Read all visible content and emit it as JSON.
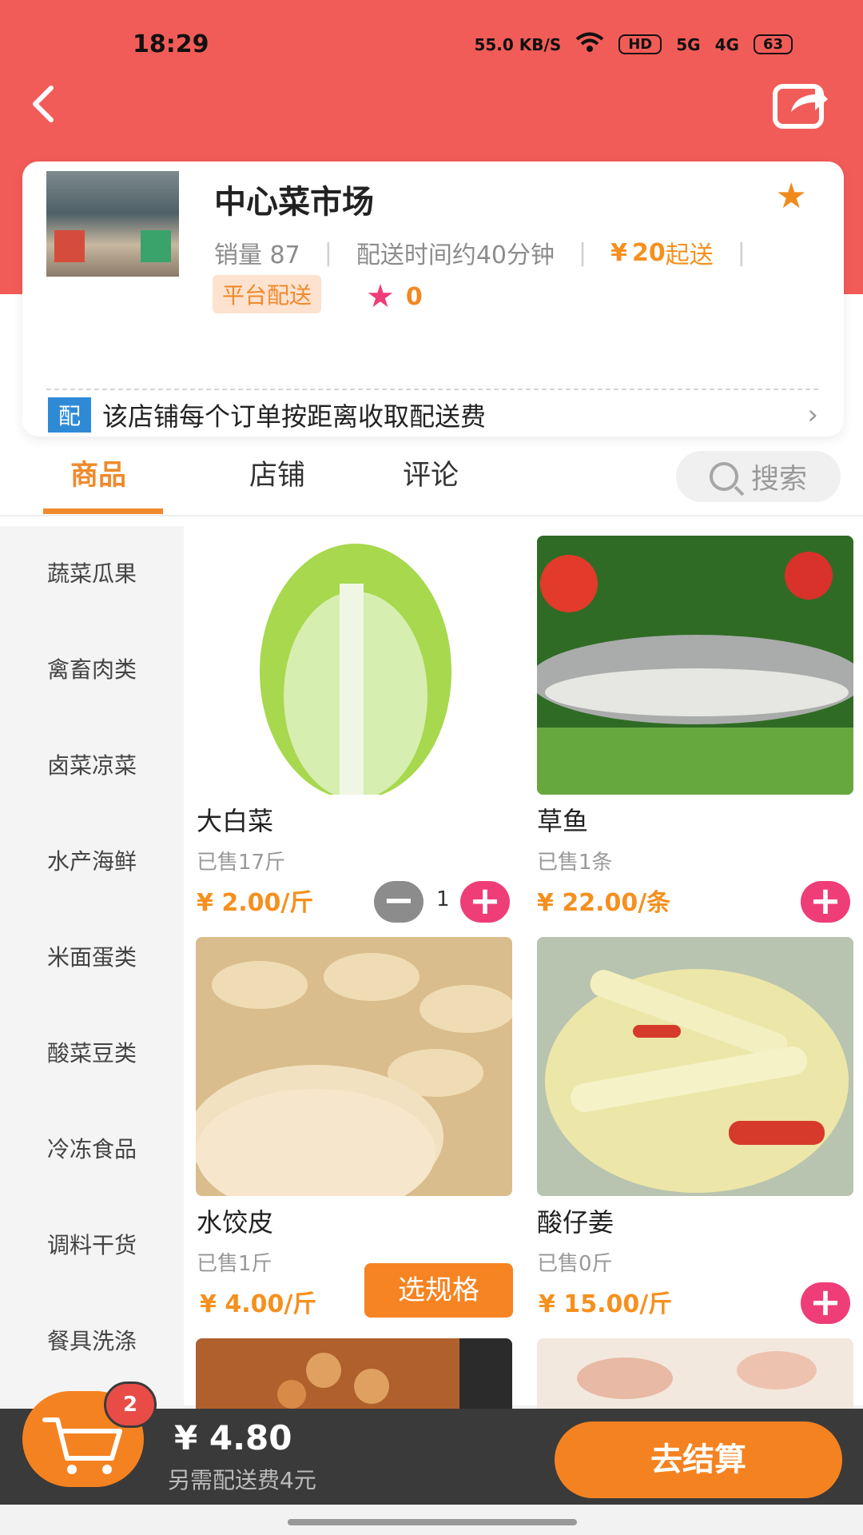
{
  "status_bar": {
    "time": "18:29",
    "net_speed": "55.0 KB/S",
    "hd": "HD",
    "signal_5g": "5G",
    "signal_4g": "4G",
    "battery": "63"
  },
  "shop": {
    "name": "中心菜市场",
    "sales": "销量 87",
    "delivery_time": "配送时间约40分钟",
    "min_price_symbol": "¥",
    "min_price_value": "20",
    "min_price_suffix": "起送",
    "delivery_badge": "平台配送",
    "rating": "0",
    "notice_tag": "配",
    "notice_text": "该店铺每个订单按距离收取配送费"
  },
  "tabs": [
    {
      "label": "商品"
    },
    {
      "label": "店铺"
    },
    {
      "label": "评论"
    }
  ],
  "search": {
    "placeholder": "搜索"
  },
  "categories": [
    {
      "label": "蔬菜瓜果"
    },
    {
      "label": "禽畜肉类"
    },
    {
      "label": "卤菜凉菜"
    },
    {
      "label": "水产海鲜"
    },
    {
      "label": "米面蛋类"
    },
    {
      "label": "酸菜豆类"
    },
    {
      "label": "冷冻食品"
    },
    {
      "label": "调料干货"
    },
    {
      "label": "餐具洗涤"
    }
  ],
  "products": [
    {
      "name": "大白菜",
      "sold": "已售17斤",
      "price": "¥ 2.00/斤",
      "qty": "1"
    },
    {
      "name": "草鱼",
      "sold": "已售1条",
      "price": "¥ 22.00/条"
    },
    {
      "name": "水饺皮",
      "sold": "已售1斤",
      "price": "¥ 4.00/斤",
      "spec_label": "选规格"
    },
    {
      "name": "酸仔姜",
      "sold": "已售0斤",
      "price": "¥ 15.00/斤"
    }
  ],
  "cart": {
    "count": "2",
    "total": "¥ 4.80",
    "fee_note": "另需配送费4元",
    "checkout_label": "去结算"
  },
  "colors": {
    "header": "#f25c58",
    "accent": "#f08a2c",
    "pink": "#ef3d77",
    "checkout": "#f58220"
  }
}
